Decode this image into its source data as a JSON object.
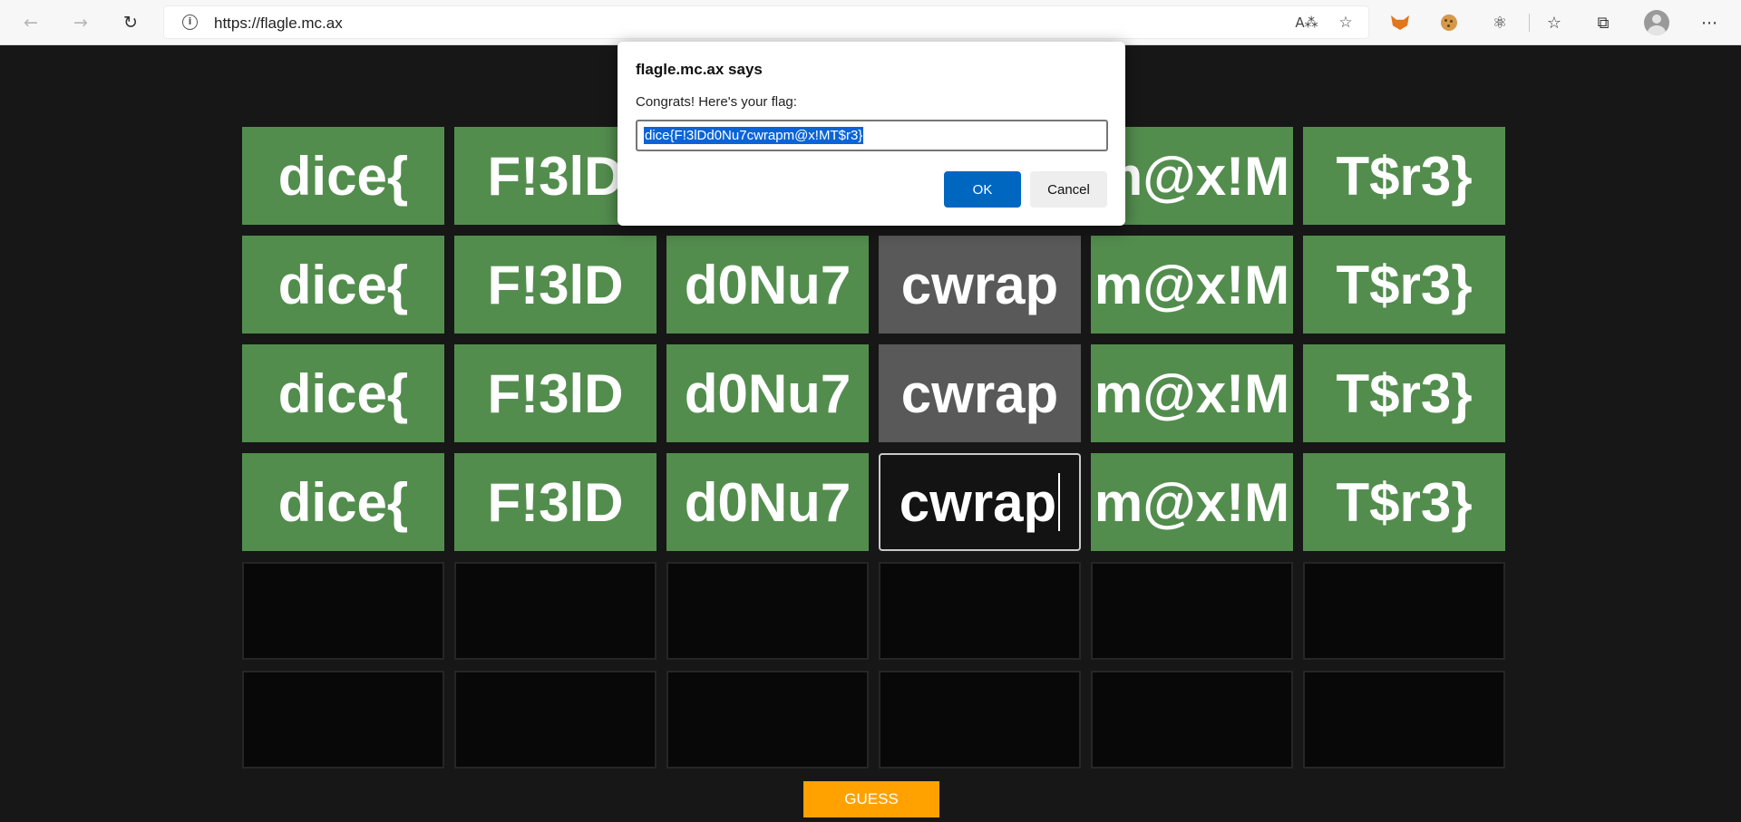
{
  "browser": {
    "url": "https://flagle.mc.ax",
    "icons": {
      "back": "back-arrow-icon",
      "forward": "forward-arrow-icon",
      "refresh": "refresh-icon",
      "site_info": "info-icon",
      "read_aloud": "read-aloud-icon",
      "favorite": "add-favorite-icon",
      "metamask": "metamask-fox-icon",
      "cookie": "cookie-icon",
      "extensions": "puzzle-extensions-icon",
      "favorites": "favorites-list-icon",
      "collections": "collections-icon",
      "profile": "profile-avatar-icon",
      "more": "more-menu-icon"
    }
  },
  "game": {
    "rows": [
      [
        {
          "text": "dice{",
          "state": "correct"
        },
        {
          "text": "F!3lD",
          "state": "correct"
        },
        {
          "text": "",
          "state": "correct"
        },
        {
          "text": "",
          "state": "correct"
        },
        {
          "text": "m@x!M",
          "state": "correct"
        },
        {
          "text": "T$r3}",
          "state": "correct"
        }
      ],
      [
        {
          "text": "dice{",
          "state": "correct"
        },
        {
          "text": "F!3lD",
          "state": "correct"
        },
        {
          "text": "d0Nu7",
          "state": "correct"
        },
        {
          "text": "cwrap",
          "state": "wrong"
        },
        {
          "text": "m@x!M",
          "state": "correct"
        },
        {
          "text": "T$r3}",
          "state": "correct"
        }
      ],
      [
        {
          "text": "dice{",
          "state": "correct"
        },
        {
          "text": "F!3lD",
          "state": "correct"
        },
        {
          "text": "d0Nu7",
          "state": "correct"
        },
        {
          "text": "cwrap",
          "state": "wrong"
        },
        {
          "text": "m@x!M",
          "state": "correct"
        },
        {
          "text": "T$r3}",
          "state": "correct"
        }
      ],
      [
        {
          "text": "dice{",
          "state": "correct"
        },
        {
          "text": "F!3lD",
          "state": "correct"
        },
        {
          "text": "d0Nu7",
          "state": "correct"
        },
        {
          "text": "cwrap",
          "state": "active"
        },
        {
          "text": "m@x!M",
          "state": "correct"
        },
        {
          "text": "T$r3}",
          "state": "correct"
        }
      ],
      [
        {
          "text": "",
          "state": "empty"
        },
        {
          "text": "",
          "state": "empty"
        },
        {
          "text": "",
          "state": "empty"
        },
        {
          "text": "",
          "state": "empty"
        },
        {
          "text": "",
          "state": "empty"
        },
        {
          "text": "",
          "state": "empty"
        }
      ],
      [
        {
          "text": "",
          "state": "empty"
        },
        {
          "text": "",
          "state": "empty"
        },
        {
          "text": "",
          "state": "empty"
        },
        {
          "text": "",
          "state": "empty"
        },
        {
          "text": "",
          "state": "empty"
        },
        {
          "text": "",
          "state": "empty"
        }
      ]
    ],
    "guess_label": "GUESS",
    "colors": {
      "correct": "#538d4e",
      "wrong": "#595959",
      "empty": "#080808",
      "guess_button": "#ffa200",
      "background": "#171717"
    }
  },
  "dialog": {
    "title": "flagle.mc.ax says",
    "message": "Congrats! Here's your flag:",
    "input_value": "dice{F!3lDd0Nu7cwrapm@x!MT$r3}",
    "ok_label": "OK",
    "cancel_label": "Cancel",
    "ok_color": "#0067c0"
  }
}
